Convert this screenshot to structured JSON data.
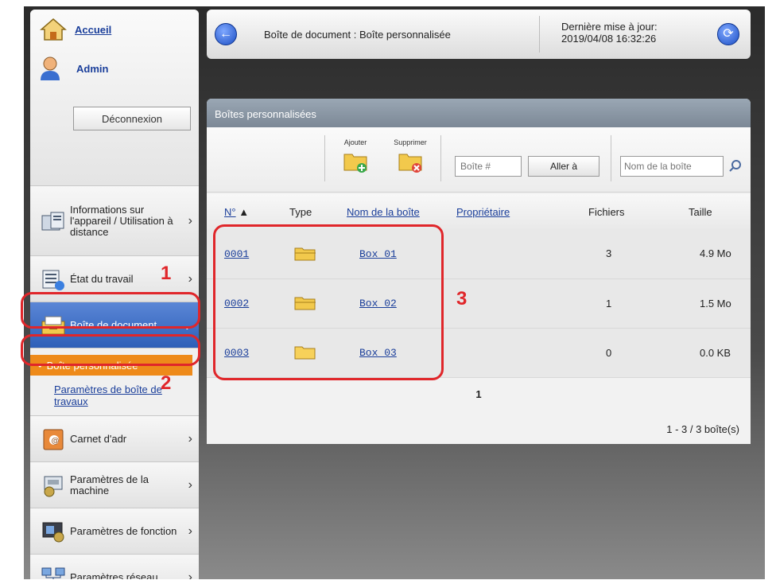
{
  "sidebar": {
    "home_label": "Accueil",
    "user_label": "Admin",
    "logout_label": "Déconnexion",
    "items": [
      {
        "label": "Informations sur l'appareil / Utilisation à distance",
        "icon": "device-info-icon"
      },
      {
        "label": "État du travail",
        "icon": "job-status-icon"
      },
      {
        "label": "Boîte de document",
        "icon": "document-box-icon"
      },
      {
        "label": "Carnet d'adr",
        "icon": "address-book-icon"
      },
      {
        "label": "Paramètres de la machine",
        "icon": "machine-settings-icon"
      },
      {
        "label": "Paramètres de fonction",
        "icon": "function-settings-icon"
      },
      {
        "label": "Paramètres réseau",
        "icon": "network-settings-icon"
      }
    ],
    "sub_active": "Boîte personnalisée",
    "sub_link": "Paramètres de boîte de travaux"
  },
  "header": {
    "title": "Boîte de document : Boîte personnalisée",
    "update_label": "Dernière mise à jour:",
    "update_time": "2019/04/08 16:32:26"
  },
  "panel": {
    "title": "Boîtes personnalisées",
    "add_label": "Ajouter",
    "delete_label": "Supprimer",
    "box_placeholder": "Boîte #",
    "goto_label": "Aller à",
    "name_placeholder": "Nom de la boîte",
    "columns": {
      "number": "N°",
      "type": "Type",
      "name": "Nom de la boîte",
      "owner": "Propriétaire",
      "files": "Fichiers",
      "size": "Taille"
    },
    "rows": [
      {
        "number": "0001",
        "name": "Box 01",
        "owner": "",
        "files": "3",
        "size": "4.9 Mo"
      },
      {
        "number": "0002",
        "name": "Box 02",
        "owner": "",
        "files": "1",
        "size": "1.5 Mo"
      },
      {
        "number": "0003",
        "name": "Box 03",
        "owner": "",
        "files": "0",
        "size": "0.0 KB"
      }
    ],
    "page": "1",
    "summary": "1 - 3 / 3 boîte(s)"
  },
  "annotations": {
    "one": "1",
    "two": "2",
    "three": "3"
  },
  "colors": {
    "accent": "#2e5fb8",
    "highlight": "#ee8a1a",
    "callout": "#e0262a"
  }
}
